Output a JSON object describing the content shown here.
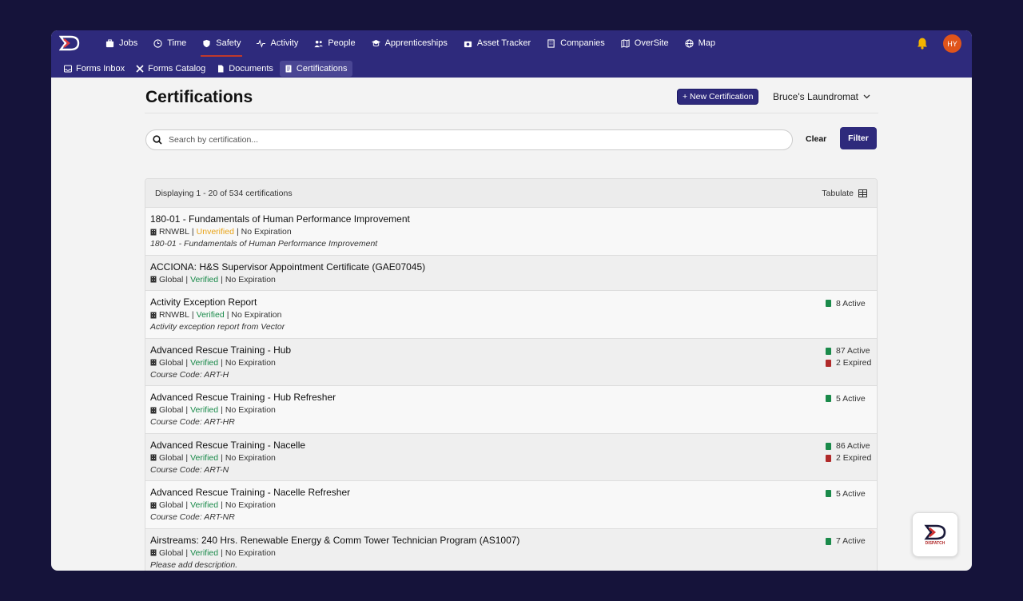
{
  "app": {
    "logo": "dispatch-logo",
    "user_initials": "HY"
  },
  "nav": [
    {
      "label": "Jobs",
      "icon": "briefcase-icon"
    },
    {
      "label": "Time",
      "icon": "clock-icon"
    },
    {
      "label": "Safety",
      "icon": "shield-icon",
      "active": true
    },
    {
      "label": "Activity",
      "icon": "pulse-icon"
    },
    {
      "label": "People",
      "icon": "people-icon"
    },
    {
      "label": "Apprenticeships",
      "icon": "graduation-cap-icon"
    },
    {
      "label": "Asset Tracker",
      "icon": "camera-icon"
    },
    {
      "label": "Companies",
      "icon": "building-icon"
    },
    {
      "label": "OverSite",
      "icon": "map-book-icon"
    },
    {
      "label": "Map",
      "icon": "globe-icon"
    }
  ],
  "subnav": [
    {
      "label": "Forms Inbox",
      "icon": "inbox-icon"
    },
    {
      "label": "Forms Catalog",
      "icon": "tools-icon"
    },
    {
      "label": "Documents",
      "icon": "document-icon"
    },
    {
      "label": "Certifications",
      "icon": "certificate-icon",
      "active": true
    }
  ],
  "page": {
    "title": "Certifications",
    "new_button": "+ New Certification",
    "company": "Bruce's Laundromat",
    "search_placeholder": "Search by certification...",
    "clear_label": "Clear",
    "filter_label": "Filter",
    "display_text": "Displaying 1 - 20 of 534 certifications",
    "tabulate_label": "Tabulate"
  },
  "rows": [
    {
      "title": "180-01 - Fundamentals of Human Performance Improvement",
      "org": "RNWBL",
      "status": "Unverified",
      "expiration": "No Expiration",
      "desc": "180-01 - Fundamentals of Human Performance Improvement",
      "active": "",
      "expired": ""
    },
    {
      "title": "ACCIONA: H&S Supervisor Appointment Certificate (GAE07045)",
      "org": "Global",
      "status": "Verified",
      "expiration": "No Expiration",
      "desc": "",
      "active": "",
      "expired": ""
    },
    {
      "title": "Activity Exception Report",
      "org": "RNWBL",
      "status": "Verified",
      "expiration": "No Expiration",
      "desc": "Activity exception report from Vector",
      "active": "8 Active",
      "expired": ""
    },
    {
      "title": "Advanced Rescue Training - Hub",
      "org": "Global",
      "status": "Verified",
      "expiration": "No Expiration",
      "desc": "Course Code: ART-H",
      "active": "87 Active",
      "expired": "2 Expired"
    },
    {
      "title": "Advanced Rescue Training - Hub Refresher",
      "org": "Global",
      "status": "Verified",
      "expiration": "No Expiration",
      "desc": "Course Code: ART-HR",
      "active": "5 Active",
      "expired": ""
    },
    {
      "title": "Advanced Rescue Training - Nacelle",
      "org": "Global",
      "status": "Verified",
      "expiration": "No Expiration",
      "desc": "Course Code: ART-N",
      "active": "86 Active",
      "expired": "2 Expired"
    },
    {
      "title": "Advanced Rescue Training - Nacelle Refresher",
      "org": "Global",
      "status": "Verified",
      "expiration": "No Expiration",
      "desc": "Course Code: ART-NR",
      "active": "5 Active",
      "expired": ""
    },
    {
      "title": "Airstreams: 240 Hrs. Renewable Energy & Comm Tower Technician Program (AS1007)",
      "org": "Global",
      "status": "Verified",
      "expiration": "No Expiration",
      "desc": "Please add description.",
      "active": "7 Active",
      "expired": ""
    }
  ],
  "badge": {
    "text": "DISPATCH"
  }
}
